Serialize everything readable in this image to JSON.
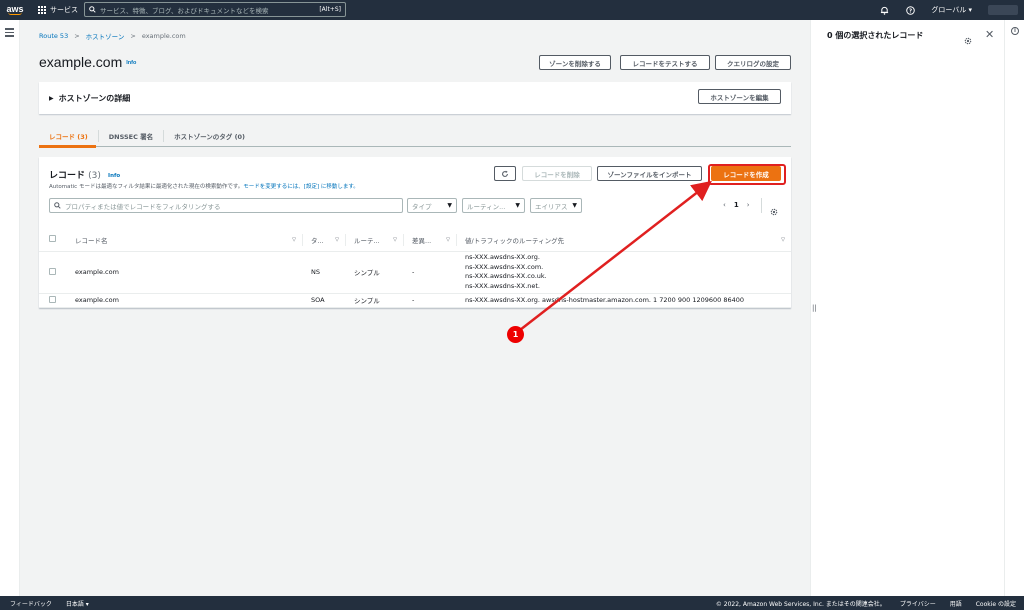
{
  "topnav": {
    "services_label": "サービス",
    "search_placeholder": "サービス、特徴、ブログ、およびドキュメントなどを検索",
    "search_shortcut": "[Alt+S]",
    "region_label": "グローバル ▾"
  },
  "breadcrumb": [
    "Route 53",
    "ホストゾーン",
    "example.com"
  ],
  "page": {
    "title": "example.com",
    "info": "Info",
    "buttons": [
      "ゾーンを削除する",
      "レコードをテストする",
      "クエリログの設定"
    ]
  },
  "hosted_zone": {
    "title": "ホストゾーンの詳細",
    "edit_button": "ホストゾーンを編集"
  },
  "tabs": [
    "レコード (3)",
    "DNSSEC 署名",
    "ホストゾーンのタグ (0)"
  ],
  "records": {
    "title": "レコード",
    "count": "(3)",
    "info": "Info",
    "desc_prefix": "Automatic モードは最適なフィルタ結果に最適化された現在の検索動作です。",
    "desc_link": "モードを変更するには、[設定] に移動します。",
    "delete_button": "レコードを削除",
    "import_button": "ゾーンファイルをインポート",
    "create_button": "レコードを作成",
    "filter_placeholder": "プロパティまたは値でレコードをフィルタリングする",
    "filters": [
      "タイプ",
      "ルーティン...",
      "エイリアス"
    ],
    "page_number": "1",
    "columns": [
      "レコード名",
      "タ...",
      "ルーテ...",
      "差異...",
      "値/トラフィックのルーティング先"
    ],
    "rows": [
      {
        "name": "example.com",
        "type": "NS",
        "routing": "シンプル",
        "diff": "-",
        "values": [
          "ns-XXX.awsdns-XX.org.",
          "ns-XXX.awsdns-XX.com.",
          "ns-XXX.awsdns-XX.co.uk.",
          "ns-XXX.awsdns-XX.net."
        ]
      },
      {
        "name": "example.com",
        "type": "SOA",
        "routing": "シンプル",
        "diff": "-",
        "values": [
          "ns-XXX.awsdns-XX.org. awsdns-hostmaster.amazon.com. 1 7200 900 1209600 86400"
        ]
      }
    ]
  },
  "right_panel": {
    "title": "0 個の選択されたレコード"
  },
  "annotation": {
    "badge": "1",
    "color": "#e02020"
  },
  "footer": {
    "feedback": "フィードバック",
    "language": "日本語 ▾",
    "copyright": "© 2022, Amazon Web Services, Inc. またはその関連会社。",
    "privacy": "プライバシー",
    "terms": "用語",
    "cookie": "Cookie の設定"
  },
  "colors": {
    "nav_bg": "#232f3e",
    "accent": "#ec7211",
    "link": "#0073bb"
  }
}
